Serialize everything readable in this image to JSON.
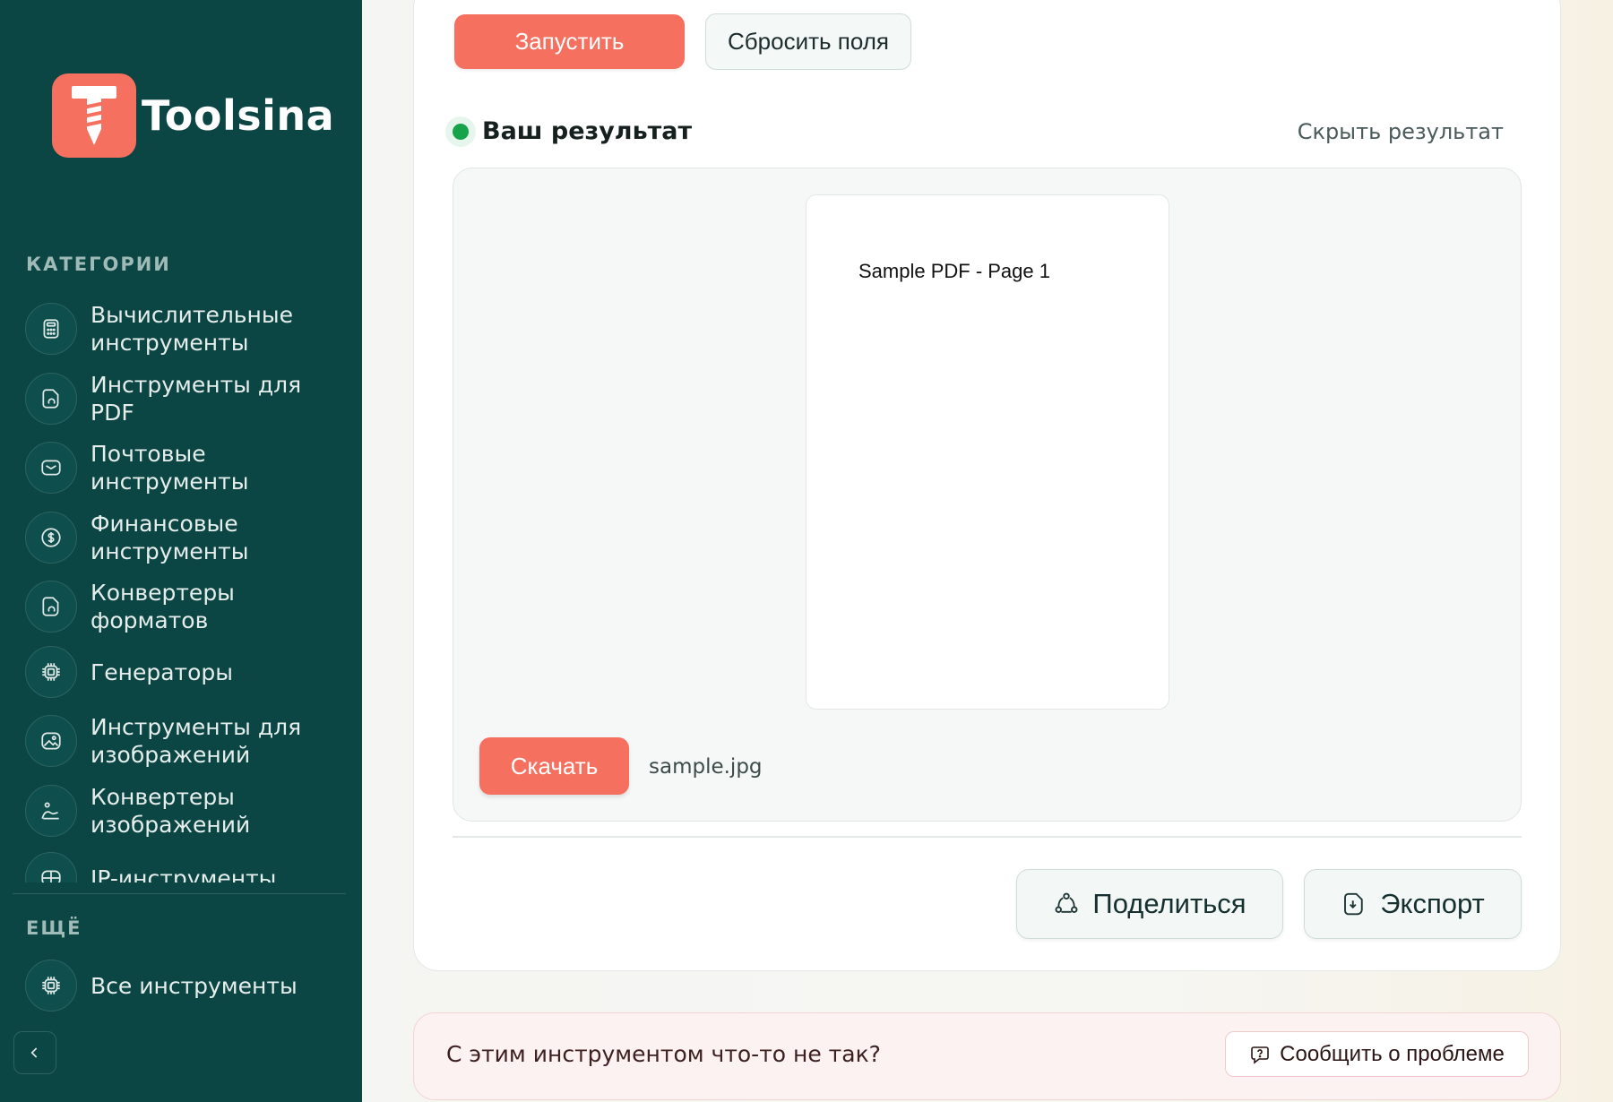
{
  "brand": {
    "name": "Toolsina",
    "color": "#f6705f",
    "sidebar_bg": "#0b4645"
  },
  "sidebar": {
    "categories_title": "КАТЕГОРИИ",
    "items": [
      {
        "label": "Вычислительные инструменты",
        "icon": "calculator-icon"
      },
      {
        "label": "Инструменты для PDF",
        "icon": "pdf-file-icon"
      },
      {
        "label": "Почтовые инструменты",
        "icon": "mail-icon"
      },
      {
        "label": "Финансовые инструменты",
        "icon": "dollar-icon"
      },
      {
        "label": "Конвертеры форматов",
        "icon": "file-convert-icon"
      },
      {
        "label": "Генераторы",
        "icon": "chip-icon"
      },
      {
        "label": "Инструменты для изображений",
        "icon": "image-icon"
      },
      {
        "label": "Конвертеры изображений",
        "icon": "image-convert-icon"
      },
      {
        "label": "IP-инструменты",
        "icon": "network-icon"
      }
    ],
    "more_title": "ЕЩЁ",
    "more_items": [
      {
        "label": "Все инструменты",
        "icon": "chip-icon"
      }
    ]
  },
  "actions": {
    "run_label": "Запустить",
    "reset_label": "Сбросить поля"
  },
  "result": {
    "title": "Ваш результат",
    "hide_label": "Скрыть результат",
    "pdf_preview_text": "Sample PDF - Page 1",
    "download_label": "Скачать",
    "file_name": "sample.jpg",
    "status_color": "#17a34a"
  },
  "footer_actions": {
    "share_label": "Поделиться",
    "export_label": "Экспорт"
  },
  "problem": {
    "text": "С этим инструментом что-то не так?",
    "report_label": "Сообщить о проблеме"
  }
}
